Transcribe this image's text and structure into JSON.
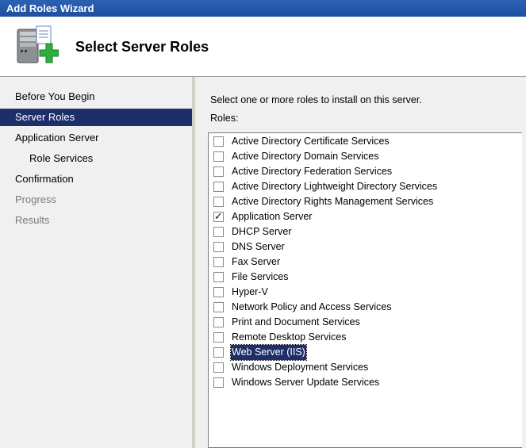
{
  "window": {
    "title": "Add Roles Wizard"
  },
  "header": {
    "title": "Select Server Roles",
    "icon": "server-add-icon"
  },
  "sidebar": {
    "items": [
      {
        "label": "Before You Begin",
        "state": "normal"
      },
      {
        "label": "Server Roles",
        "state": "selected"
      },
      {
        "label": "Application Server",
        "state": "normal"
      },
      {
        "label": "Role Services",
        "state": "normal"
      },
      {
        "label": "Confirmation",
        "state": "normal"
      },
      {
        "label": "Progress",
        "state": "disabled"
      },
      {
        "label": "Results",
        "state": "disabled"
      }
    ]
  },
  "main": {
    "instruction": "Select one or more roles to install on this server.",
    "roles_label": "Roles:",
    "roles": [
      {
        "label": "Active Directory Certificate Services",
        "checked": false
      },
      {
        "label": "Active Directory Domain Services",
        "checked": false
      },
      {
        "label": "Active Directory Federation Services",
        "checked": false
      },
      {
        "label": "Active Directory Lightweight Directory Services",
        "checked": false
      },
      {
        "label": "Active Directory Rights Management Services",
        "checked": false
      },
      {
        "label": "Application Server",
        "checked": true
      },
      {
        "label": "DHCP Server",
        "checked": false
      },
      {
        "label": "DNS Server",
        "checked": false
      },
      {
        "label": "Fax Server",
        "checked": false
      },
      {
        "label": "File Services",
        "checked": false
      },
      {
        "label": "Hyper-V",
        "checked": false
      },
      {
        "label": "Network Policy and Access Services",
        "checked": false
      },
      {
        "label": "Print and Document Services",
        "checked": false
      },
      {
        "label": "Remote Desktop Services",
        "checked": false
      },
      {
        "label": "Web Server (IIS)",
        "checked": false,
        "focused": true
      },
      {
        "label": "Windows Deployment Services",
        "checked": false
      },
      {
        "label": "Windows Server Update Services",
        "checked": false
      }
    ]
  },
  "colors": {
    "titlebar": "#1e4f9e",
    "selection": "#1d2f68",
    "panel": "#f0f0f0"
  }
}
